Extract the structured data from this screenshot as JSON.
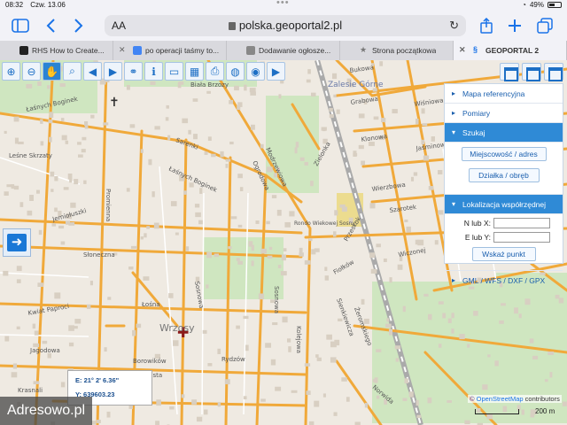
{
  "status": {
    "time": "08:32",
    "date": "Czw. 13.06",
    "battery": "49%",
    "battery_level": 0.49
  },
  "browser": {
    "text_size": "AA",
    "url": "polska.geoportal2.pl",
    "tabs": [
      {
        "label": "RHS How to Create...",
        "favicon_color": "#222222"
      },
      {
        "label": "po operacji taśmy to...",
        "favicon_color": "#4285f4"
      },
      {
        "label": "Dodawanie ogłosze...",
        "favicon_color": "#888888"
      },
      {
        "label": "Strona początkowa",
        "favicon_color": "#777777"
      },
      {
        "label": "GEOPORTAL 2",
        "favicon_color": "#1a73e8",
        "active": true
      }
    ]
  },
  "map_toolbar": {
    "icons": [
      "zoom-in-icon",
      "zoom-out-icon",
      "hand-icon",
      "search-icon",
      "arrow-left-icon",
      "arrow-right-icon",
      "link-icon",
      "info-icon",
      "ruler-icon",
      "area-icon",
      "print-icon",
      "globe-icon",
      "record-icon",
      "video-icon"
    ]
  },
  "panel": {
    "sections": {
      "mapa": "Mapa referencyjna",
      "pomiary": "Pomiary",
      "szukaj": "Szukaj",
      "btn_miejscowosc": "Miejscowość / adres",
      "btn_dzialka": "Działka / obręb",
      "lokalizacja": "Lokalizacja współrzędnej",
      "n_label": "N lub X:",
      "e_label": "E lub Y:",
      "btn_wskaz": "Wskaż punkt",
      "gml": "GML / WFS / DXF / GPX"
    }
  },
  "coords": {
    "e": "E:  21° 2' 6.36\"",
    "y": "Y:  639603.23"
  },
  "attribution": {
    "copy": "©",
    "osm": "OpenStreetMap",
    "rest": " contributors"
  },
  "scale": {
    "label": "200 m"
  },
  "watermark": "Adresowo.pl",
  "street_labels": [
    "Łaśnych Boginek",
    "Sarenki",
    "Łaśnych Boginek",
    "Promienna",
    "Słoneczna",
    "Jemiołuszki",
    "Rydzów",
    "Borowików",
    "Kwiat Paproci",
    "Jagodowa",
    "Łośna",
    "Sosnowa",
    "Klonowa",
    "Wiśniowa",
    "Jaśminowa",
    "Wierzbowa",
    "Szarotek",
    "Zielonka",
    "Grabowa",
    "Bukowa",
    "Przeskok",
    "Fiołków",
    "Wiczonej",
    "Modrzewiowa",
    "Ogrodowa",
    "Sosnowa",
    "Norwida",
    "Sienkiewicza",
    "Żeromskiego",
    "Kolejowa",
    "Rondo Wiekowej Sosny",
    "Wrzosy",
    "Zalesie Górne",
    "Leśne Skrzaty",
    "Biała Brzozy",
    "Krasnali",
    "Cienista"
  ]
}
